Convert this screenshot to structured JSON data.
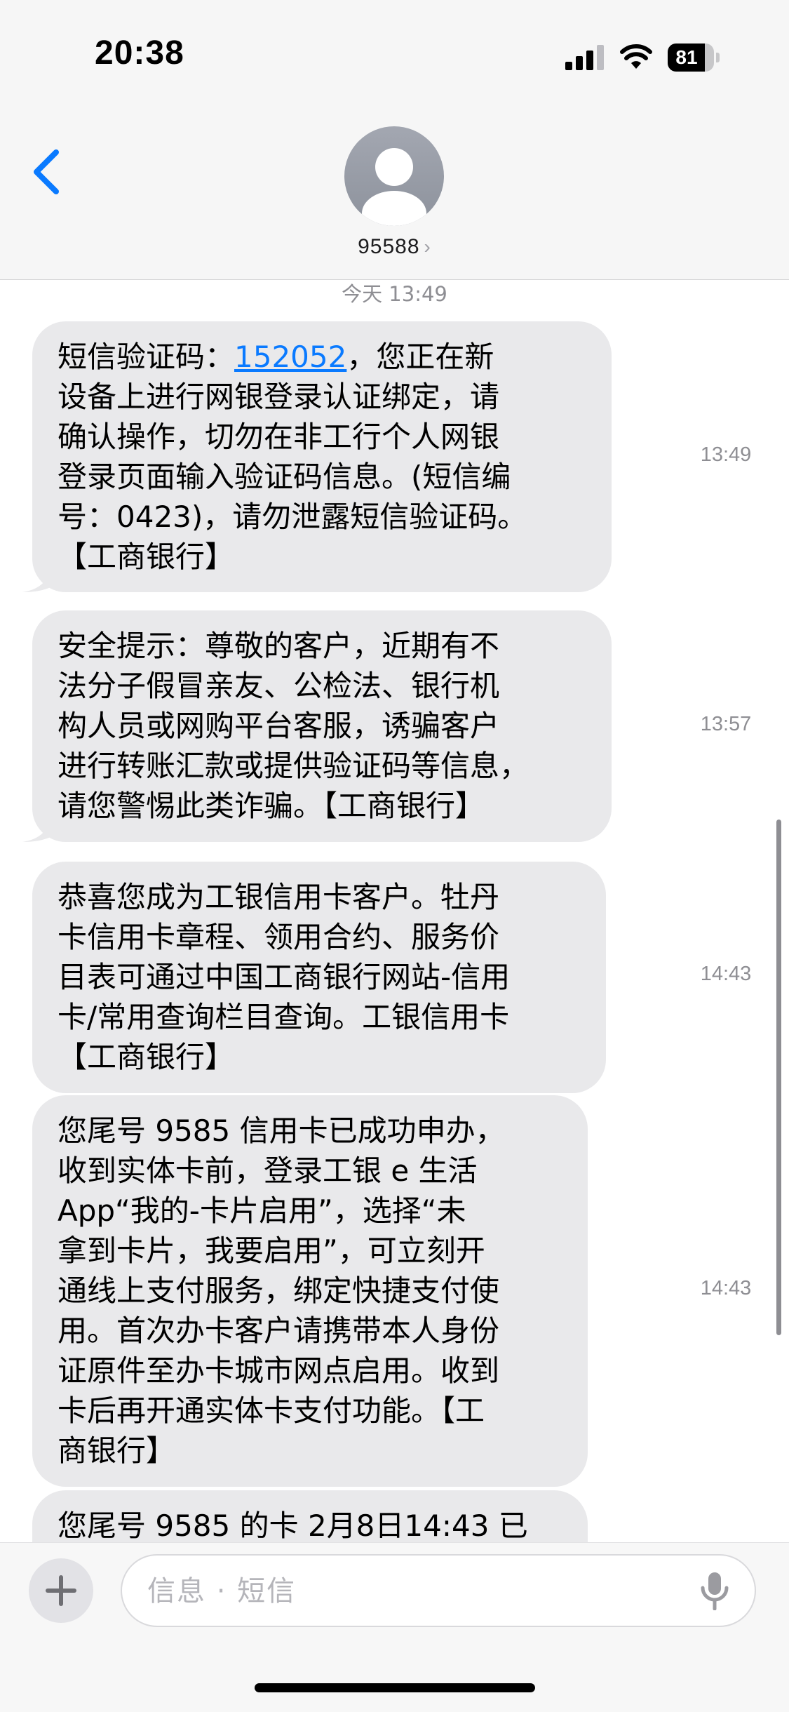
{
  "status_bar": {
    "time": "20:38",
    "battery_level": "81",
    "battery_fraction": 0.81
  },
  "header": {
    "contact_name": "95588",
    "back_icon": "chevron-left-icon",
    "avatar_icon": "person-silhouette-icon",
    "accent_color": "#0a7aff"
  },
  "conversation": {
    "date_header": "今天 13:49",
    "messages": [
      {
        "time": "13:49",
        "code": "152052",
        "text_before_code": "短信验证码：",
        "text_after_code": "，您正在新\n设备上进行网银登录认证绑定，请\n确认操作，切勿在非工行个人网银\n登录页面输入验证码信息。(短信编\n号：0423)，请勿泄露短信验证码。\n【工商银行】"
      },
      {
        "time": "13:57",
        "text": "安全提示：尊敬的客户，近期有不\n法分子假冒亲友、公检法、银行机\n构人员或网购平台客服，诱骗客户\n进行转账汇款或提供验证码等信息，\n请您警惕此类诈骗。【工商银行】"
      },
      {
        "time": "14:43",
        "text": "恭喜您成为工银信用卡客户。牡丹\n卡信用卡章程、领用合约、服务价\n目表可通过中国工商银行网站-信用\n卡/常用查询栏目查询。工银信用卡\n【工商银行】"
      },
      {
        "time": "14:43",
        "text": "您尾号 9585 信用卡已成功申办，\n收到实体卡前，登录工银 e 生活\nApp“我的-卡片启用”，选择“未\n拿到卡片，我要启用”，可立刻开\n通线上支付服务，绑定快捷支付使\n用。首次办卡客户请携带本人身份\n证原件至办卡城市网点启用。收到\n卡后再开通实体卡支付功能。【工\n商银行】"
      },
      {
        "text": "您尾号 9585 的卡 2月8日14:43 已"
      }
    ]
  },
  "input_bar": {
    "placeholder": "信息 · 短信",
    "plus_label": "+",
    "mic_icon": "microphone-icon"
  }
}
